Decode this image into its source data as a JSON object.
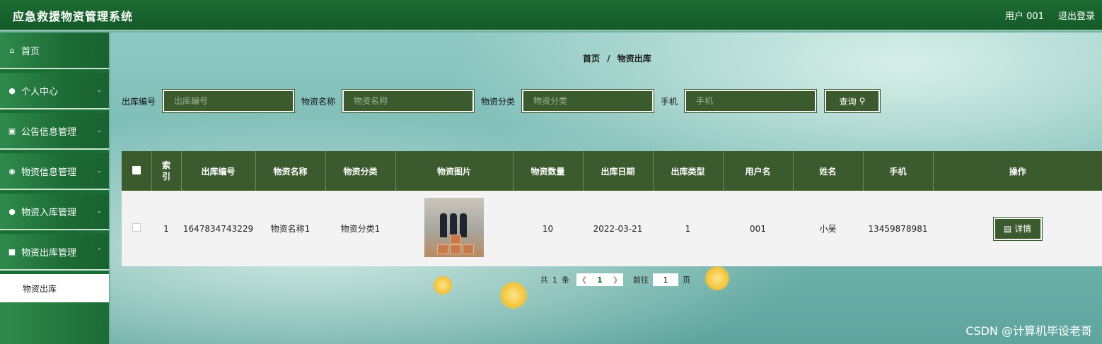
{
  "header": {
    "app_title": "应急救援物资管理系统",
    "user_label": "用户 001",
    "logout_label": "退出登录"
  },
  "sidebar": {
    "items": [
      {
        "label": "首页",
        "icon": "home-icon"
      },
      {
        "label": "个人中心",
        "icon": "user-icon"
      },
      {
        "label": "公告信息管理",
        "icon": "briefcase-icon"
      },
      {
        "label": "物资信息管理",
        "icon": "database-icon"
      },
      {
        "label": "物资入库管理",
        "icon": "user-icon"
      },
      {
        "label": "物资出库管理",
        "icon": "trash-icon"
      }
    ],
    "active_sub": "物资出库"
  },
  "breadcrumb": {
    "home": "首页",
    "sep": "/",
    "current": "物资出库"
  },
  "search": {
    "fields": [
      {
        "label": "出库编号",
        "placeholder": "出库编号"
      },
      {
        "label": "物资名称",
        "placeholder": "物资名称"
      },
      {
        "label": "物资分类",
        "placeholder": "物资分类"
      },
      {
        "label": "手机",
        "placeholder": "手机"
      }
    ],
    "query_label": "查询"
  },
  "table": {
    "columns": [
      "索引",
      "出库编号",
      "物资名称",
      "物资分类",
      "物资图片",
      "物资数量",
      "出库日期",
      "出库类型",
      "用户名",
      "姓名",
      "手机",
      "操作"
    ],
    "rows": [
      {
        "index": "1",
        "out_no": "1647834743229",
        "name": "物资名称1",
        "category": "物资分类1",
        "qty": "10",
        "date": "2022-03-21",
        "out_type": "1",
        "username": "001",
        "realname": "小吴",
        "phone": "13459878981",
        "action": "详情"
      }
    ]
  },
  "pagination": {
    "total_prefix": "共",
    "total": "1",
    "total_suffix": "条",
    "current_page": "1",
    "goto_prefix": "前往",
    "goto_value": "1",
    "goto_suffix": "页"
  },
  "watermark": "CSDN @计算机毕设老哥",
  "colors": {
    "header": "#1d6b33",
    "primary": "#3b5a2d",
    "sidebar": "#1a6e35"
  }
}
